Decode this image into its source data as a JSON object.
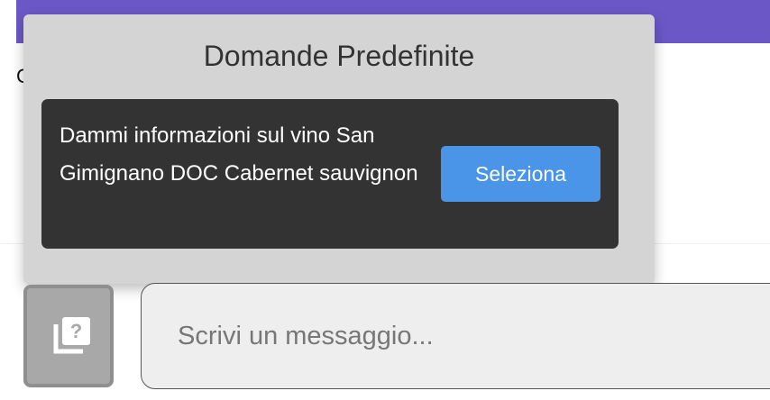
{
  "background": {
    "partial_text": "C"
  },
  "popup": {
    "title": "Domande Predefinite",
    "questions": [
      {
        "text": "Dammi informazioni sul vino San Gimignano DOC Cabernet sauvignon",
        "button_label": "Seleziona"
      }
    ]
  },
  "input_bar": {
    "toggle_icon": "question-library-icon",
    "placeholder": "Scrivi un messaggio..."
  },
  "colors": {
    "header": "#6b58c6",
    "popup_bg": "#d4d4d4",
    "card_bg": "#333333",
    "button": "#4a95e8"
  }
}
